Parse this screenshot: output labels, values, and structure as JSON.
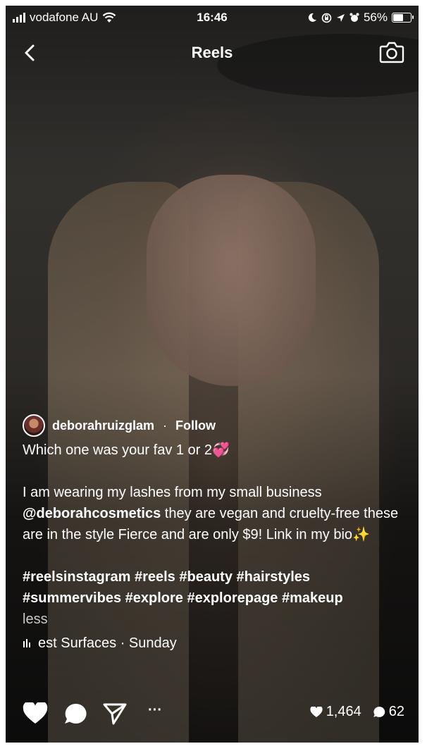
{
  "status_bar": {
    "carrier": "vodafone AU",
    "time": "16:46",
    "battery": "56%"
  },
  "nav": {
    "title": "Reels"
  },
  "post": {
    "username": "deborahruizglam",
    "separator": "·",
    "follow_label": "Follow",
    "caption_line1": "Which one was your fav 1 or 2💞",
    "caption_p2_a": "I am wearing my lashes from my small business ",
    "caption_mention": "@deborahcosmetics",
    "caption_p2_b": " they are vegan and cruelty-free these are in the style Fierce and are only $9! Link in my bio✨",
    "hashtags_line1": "#reelsinstagram #reels #beauty #hairstyles",
    "hashtags_line2": "#summervibes #explore #explorepage #makeup",
    "less_label": "less",
    "audio": "est  Surfaces · Sunday"
  },
  "actions": {
    "more_label": "···",
    "likes": "1,464",
    "comments": "62"
  },
  "colors": {
    "overlay_text": "#ffffff",
    "muted_text": "#c9c9c9"
  },
  "icons": [
    "signal-bars-icon",
    "wifi-icon",
    "moon-icon",
    "rotation-lock-icon",
    "location-icon",
    "alarm-icon",
    "battery-icon",
    "back-chevron-icon",
    "camera-icon",
    "heart-icon",
    "comment-icon",
    "share-icon",
    "audio-bars-icon"
  ]
}
